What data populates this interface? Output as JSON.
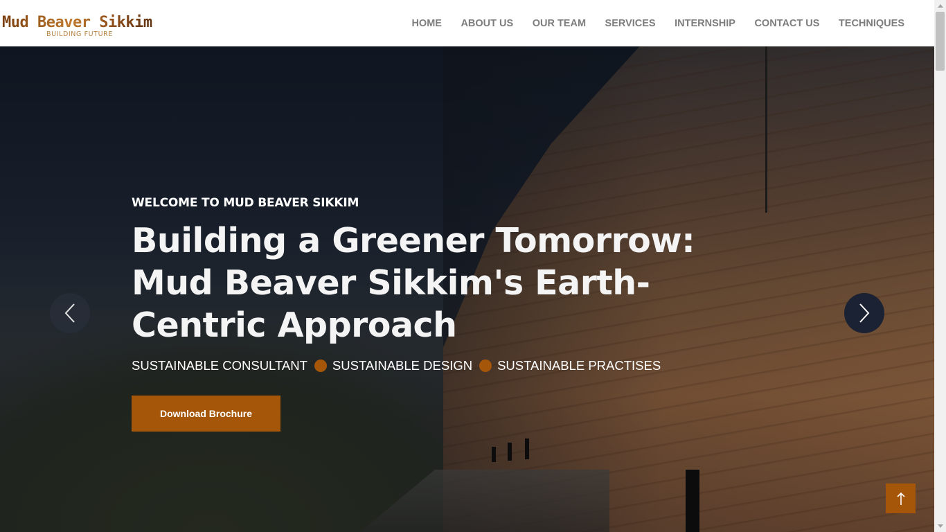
{
  "header": {
    "logo_title": "Mud Beaver Sikkim",
    "logo_subtitle": "BUILDING FUTURE",
    "nav": [
      {
        "label": "HOME"
      },
      {
        "label": "ABOUT US"
      },
      {
        "label": "OUR TEAM"
      },
      {
        "label": "SERVICES"
      },
      {
        "label": "INTERNSHIP"
      },
      {
        "label": "CONTACT US"
      },
      {
        "label": "TECHNIQUES"
      }
    ]
  },
  "hero": {
    "welcome": "WELCOME TO MUD BEAVER SIKKIM",
    "headline": "Building a Greener Tomorrow: Mud Beaver Sikkim's Earth-Centric Approach",
    "tags": [
      "SUSTAINABLE CONSULTANT",
      "SUSTAINABLE DESIGN",
      "SUSTAINABLE PRACTISES"
    ],
    "button_label": "Download Brochure",
    "prev_icon": "chevron-left-icon",
    "next_icon": "chevron-right-icon"
  },
  "back_to_top_icon": "arrow-up-icon",
  "colors": {
    "accent": "#a55609",
    "nav_text": "#7d7d7d",
    "logo_brown": "#8a4a18"
  }
}
